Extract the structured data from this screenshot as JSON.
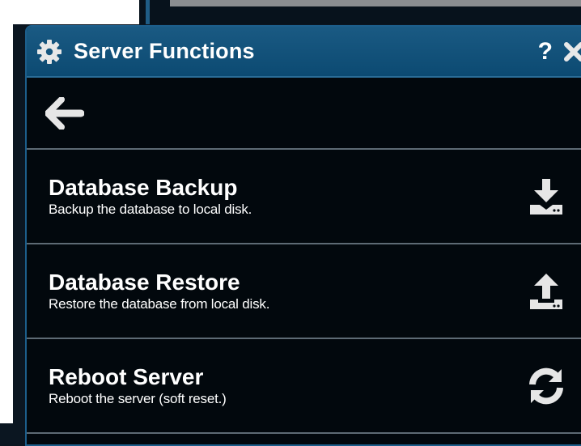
{
  "dialog": {
    "title": "Server Functions",
    "help_label": "?",
    "icons": {
      "title": "gear-icon",
      "help": "question-mark",
      "close": "close-icon",
      "back": "arrow-left-icon"
    }
  },
  "menu": {
    "items": [
      {
        "title": "Database Backup",
        "description": "Backup the database to local disk.",
        "icon": "download-icon"
      },
      {
        "title": "Database Restore",
        "description": "Restore the database from local disk.",
        "icon": "upload-icon"
      },
      {
        "title": "Reboot Server",
        "description": "Reboot the server (soft reset.)",
        "icon": "refresh-icon"
      }
    ]
  },
  "colors": {
    "titlebar": "#1a5a83",
    "panel_background": "#02080d",
    "divider": "#5d6a74",
    "text": "#ffffff",
    "icon": "#e6e6e6"
  }
}
